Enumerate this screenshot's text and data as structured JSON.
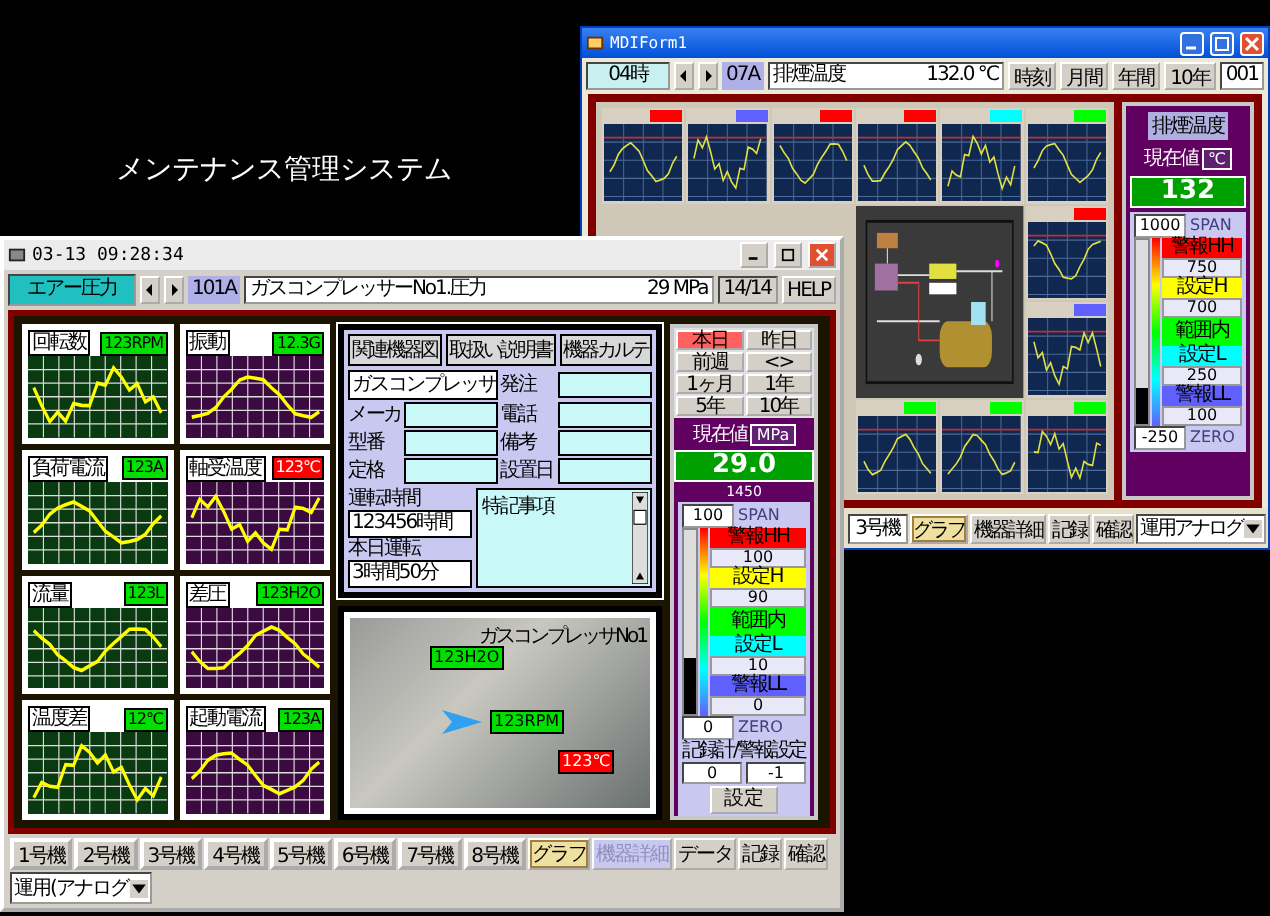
{
  "desktop_caption": "メンテナンス管理システム",
  "back_window": {
    "title": "MDIForm1",
    "toolbar": {
      "group": "04時",
      "tag": "07A",
      "name": "排煙温度",
      "reading": "132.0 ℃",
      "buttons": [
        {
          "label": "時刻"
        },
        {
          "label": "月間"
        },
        {
          "label": "年間"
        },
        {
          "label": "10年"
        }
      ],
      "page": "001"
    },
    "tiles": [
      {
        "color": "#ff0000"
      },
      {
        "color": "#6060ff"
      },
      {
        "color": "#ff0000"
      },
      {
        "color": "#ff0000"
      },
      {
        "color": "#00ffff"
      },
      {
        "color": "#00ff00"
      },
      {
        "color": "#ff0000"
      },
      {
        "color": "#6060ff"
      },
      {
        "color": "#00ff00"
      },
      {
        "color": "#00ff00"
      },
      {
        "color": "#00ff00"
      }
    ],
    "panel": {
      "label": "排煙温度",
      "caption": "現在値",
      "unit": "℃",
      "value": "132",
      "meter": {
        "span_value": "1000",
        "span": "SPAN",
        "level": 0.2,
        "zero_value": "-250",
        "zero": "ZERO",
        "bands": [
          {
            "label": "警報HH",
            "value": "750",
            "color": "#ff0000"
          },
          {
            "label": "設定H",
            "value": "700",
            "color": "#ffff00"
          },
          {
            "label": "範囲内",
            "color": "#00ff00"
          },
          {
            "label": "設定L",
            "value": "250",
            "color": "#00ffff"
          },
          {
            "label": "警報LL",
            "value": "100",
            "color": "#6060ff"
          }
        ]
      }
    },
    "bottom": {
      "unit": "3号機",
      "buttons": [
        {
          "label": "グラフ",
          "selected": true,
          "disabled": false
        },
        {
          "label": "機器詳細",
          "selected": false,
          "disabled": false
        },
        {
          "label": "記録",
          "selected": false,
          "disabled": false
        },
        {
          "label": "確認",
          "selected": false,
          "disabled": false
        }
      ],
      "dropdown": "運用アナログ"
    }
  },
  "front_window": {
    "title": "03-13 09:28:34",
    "toolbar": {
      "group": "エアー圧力",
      "tag": "101A",
      "name": "ガスコンプレッサーNo1.圧力",
      "reading": "29 MPa",
      "page": "14/14",
      "help": "HELP"
    },
    "tiles": [
      {
        "label": "回転数",
        "reading": "123RPM",
        "alarm": false,
        "color": "#0a3a10"
      },
      {
        "label": "振動",
        "reading": "12.3G",
        "alarm": false,
        "color": "#3a0a40"
      },
      {
        "label": "負荷電流",
        "reading": "123A",
        "alarm": false,
        "color": "#0a3a10"
      },
      {
        "label": "軸受温度",
        "reading": "123℃",
        "alarm": true,
        "color": "#3a0a40"
      },
      {
        "label": "流量",
        "reading": "123L",
        "alarm": false,
        "color": "#0a3a10"
      },
      {
        "label": "差圧",
        "reading": "123H2O",
        "alarm": false,
        "color": "#3a0a40"
      },
      {
        "label": "温度差",
        "reading": "12℃",
        "alarm": false,
        "color": "#0a3a10"
      },
      {
        "label": "起動電流",
        "reading": "123A",
        "alarm": false,
        "color": "#3a0a40"
      }
    ],
    "tabs": [
      {
        "label": "関連機器図"
      },
      {
        "label": "取扱い説明書"
      },
      {
        "label": "機器カルテ"
      }
    ],
    "equipment_name": "ガスコンプレッサ",
    "fields": [
      {
        "label": "発注"
      },
      {
        "label": "メーカ"
      },
      {
        "label": "電話"
      },
      {
        "label": "型番"
      },
      {
        "label": "備考"
      },
      {
        "label": "定格"
      },
      {
        "label": "設置日"
      }
    ],
    "run_time": {
      "label": "運転時間",
      "value": "123456時間"
    },
    "today_run": {
      "label": "本日運転",
      "value": "3時間50分"
    },
    "notes": {
      "label": "特記事項"
    },
    "photo": {
      "caption": "ガスコンプレッサNo1",
      "tags": [
        {
          "text": "123H2O",
          "alarm": false
        },
        {
          "text": "123RPM",
          "alarm": false
        },
        {
          "text": "123℃",
          "alarm": true
        }
      ]
    },
    "periods": [
      {
        "label": "本日",
        "selected": true
      },
      {
        "label": "昨日",
        "selected": false
      },
      {
        "label": "前週",
        "selected": false
      },
      {
        "label": "<>",
        "selected": false
      },
      {
        "label": "1ヶ月",
        "selected": false
      },
      {
        "label": "1年",
        "selected": false
      },
      {
        "label": "5年",
        "selected": false
      },
      {
        "label": "10年",
        "selected": false
      }
    ],
    "current": {
      "label": "現在値",
      "unit": "MPa",
      "value": "29.0",
      "sub": "1450"
    },
    "meter": {
      "span_value": "100",
      "span": "SPAN",
      "level": 0.3,
      "zero_value": "0",
      "zero": "ZERO",
      "bands": [
        {
          "label": "警報HH",
          "value": "100",
          "color": "#ff0000"
        },
        {
          "label": "設定H",
          "value": "90",
          "color": "#ffff00"
        },
        {
          "label": "範囲内",
          "color": "#00ff00"
        },
        {
          "label": "設定L",
          "value": "10",
          "color": "#00ffff"
        },
        {
          "label": "警報LL",
          "value": "0",
          "color": "#6060ff"
        }
      ]
    },
    "recorder": {
      "label": "記録計/警報設定",
      "values": [
        "0",
        "-1"
      ],
      "button": "設定"
    },
    "units": [
      {
        "label": "1号機"
      },
      {
        "label": "2号機"
      },
      {
        "label": "3号機"
      },
      {
        "label": "4号機"
      },
      {
        "label": "5号機"
      },
      {
        "label": "6号機"
      },
      {
        "label": "7号機"
      },
      {
        "label": "8号機"
      }
    ],
    "actions": [
      {
        "label": "グラフ",
        "selected": true,
        "disabled": false
      },
      {
        "label": "機器詳細",
        "selected": false,
        "disabled": true
      },
      {
        "label": "データ",
        "selected": false,
        "disabled": false
      },
      {
        "label": "記録",
        "selected": false,
        "disabled": false
      },
      {
        "label": "確認",
        "selected": false,
        "disabled": false
      }
    ],
    "dropdown": "運用(アナログ"
  }
}
